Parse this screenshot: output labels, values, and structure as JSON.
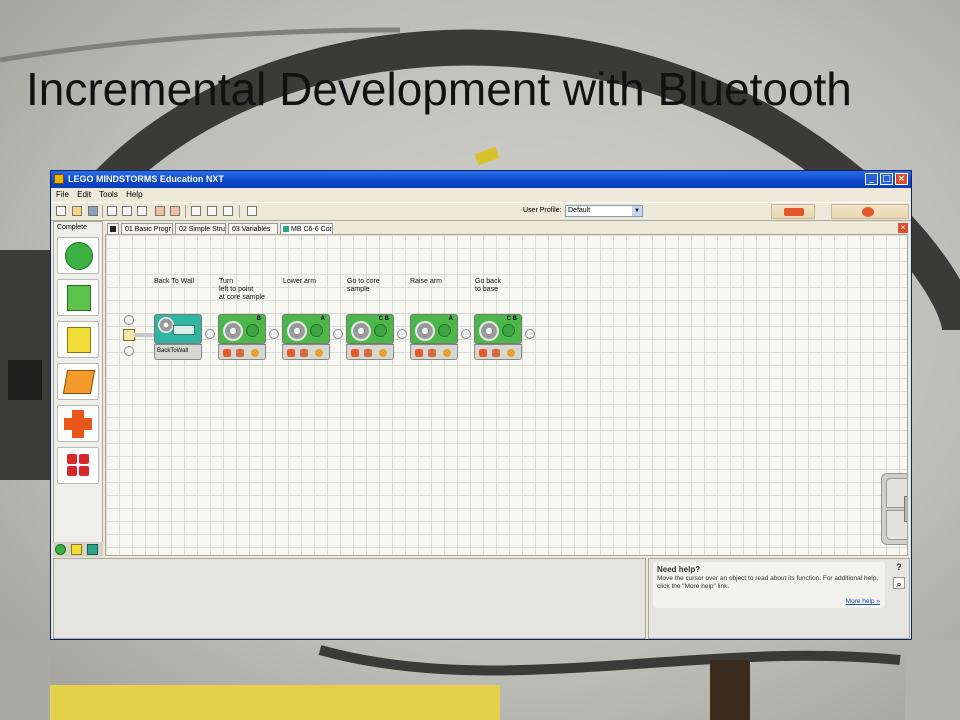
{
  "slide": {
    "title": "Incremental Development with Bluetooth"
  },
  "window": {
    "title": "LEGO MINDSTORMS Education NXT",
    "controls": [
      "_",
      "□",
      "×"
    ]
  },
  "menu": [
    "File",
    "Edit",
    "Tools",
    "Help"
  ],
  "toolbar": {
    "profile_label": "User Profile:",
    "profile_value": "Default"
  },
  "palette": {
    "label": "Complete"
  },
  "tabs": [
    {
      "label": "01 Basic Progr"
    },
    {
      "label": "02 Simple Stru"
    },
    {
      "label": "03 Variables"
    },
    {
      "label": "MB C6-6 Cor"
    }
  ],
  "blocks": [
    {
      "caption": [
        "Back To Wall"
      ],
      "label": "BackToWall",
      "port": "",
      "color": "#2fb6a2"
    },
    {
      "caption": [
        "Turn",
        "left to point",
        "at core sample"
      ],
      "port": "B",
      "color": "#4cb84a"
    },
    {
      "caption": [
        "Lower arm"
      ],
      "port": "A",
      "color": "#4cb84a"
    },
    {
      "caption": [
        "Go to core",
        "sample"
      ],
      "port": "C B",
      "color": "#4cb84a"
    },
    {
      "caption": [
        "Raise arm"
      ],
      "port": "A",
      "color": "#4cb84a"
    },
    {
      "caption": [
        "Go back",
        "to base"
      ],
      "port": "C B",
      "color": "#4cb84a"
    }
  ],
  "help": {
    "title": "Need help?",
    "text": "Move the cursor over an object to read about its function. For additional help, click the \"More help\" link.",
    "link": "More help »"
  }
}
